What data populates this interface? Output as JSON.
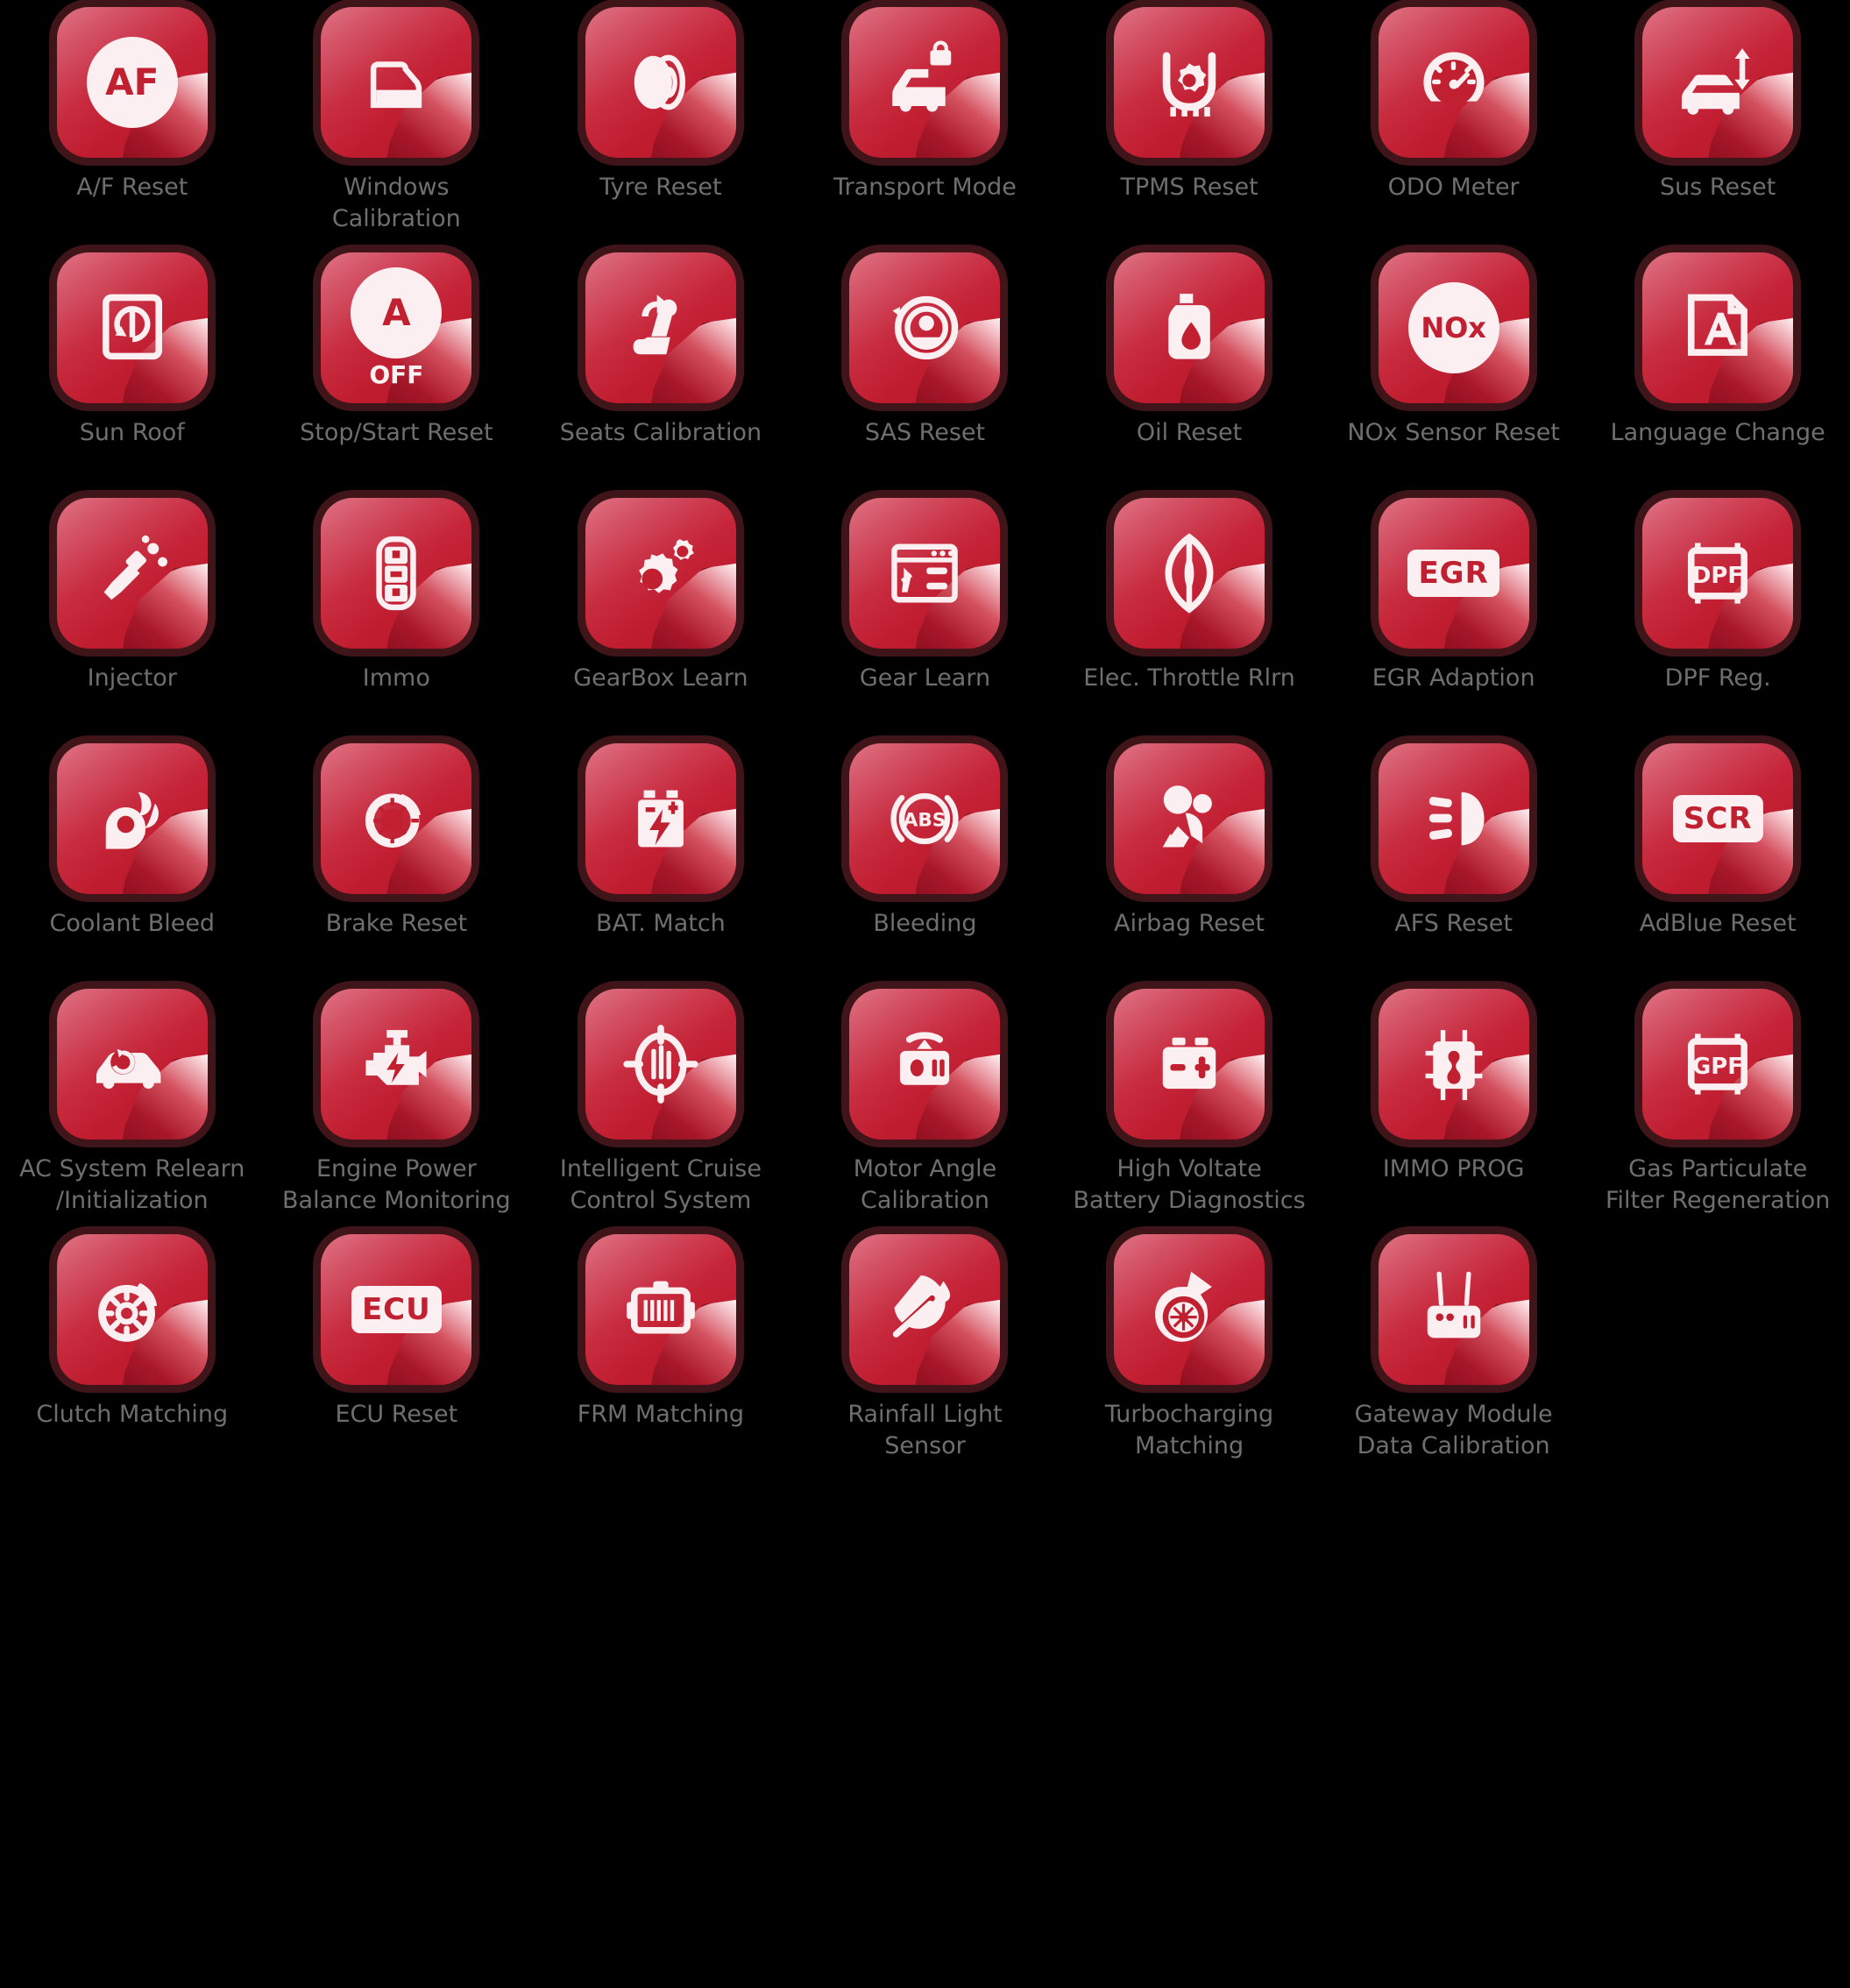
{
  "page": {
    "background_color": "#000000",
    "tile_color": "#c62438",
    "glyph_color": "#fbeff1",
    "label_color": "#6f6f6f",
    "columns": 7
  },
  "items": [
    {
      "label": "A/F Reset",
      "icon": "af-badge-icon",
      "row": 1,
      "col": 1
    },
    {
      "label": "Windows\nCalibration",
      "icon": "car-door-window-icon",
      "row": 1,
      "col": 2
    },
    {
      "label": "Tyre Reset",
      "icon": "tyre-icon",
      "row": 1,
      "col": 3
    },
    {
      "label": "Transport Mode",
      "icon": "car-lock-icon",
      "row": 1,
      "col": 4
    },
    {
      "label": "TPMS Reset",
      "icon": "tyre-pressure-gear-icon",
      "row": 1,
      "col": 5
    },
    {
      "label": "ODO Meter",
      "icon": "odometer-gauge-icon",
      "row": 1,
      "col": 6
    },
    {
      "label": "Sus Reset",
      "icon": "car-suspension-arrows-icon",
      "row": 1,
      "col": 7
    },
    {
      "label": "Sun Roof",
      "icon": "sunroof-panel-icon",
      "row": 2,
      "col": 1
    },
    {
      "label": "Stop/Start Reset",
      "icon": "a-off-badge-icon",
      "row": 2,
      "col": 2
    },
    {
      "label": "Seats Calibration",
      "icon": "seat-rotate-icon",
      "row": 2,
      "col": 3
    },
    {
      "label": "SAS Reset",
      "icon": "steering-angle-sensor-icon",
      "row": 2,
      "col": 4
    },
    {
      "label": "Oil Reset",
      "icon": "oil-can-icon",
      "row": 2,
      "col": 5
    },
    {
      "label": "NOx Sensor Reset",
      "icon": "nox-badge-icon",
      "row": 2,
      "col": 6
    },
    {
      "label": "Language Change",
      "icon": "language-book-a-icon",
      "row": 2,
      "col": 7
    },
    {
      "label": "Injector",
      "icon": "injector-spray-icon",
      "row": 3,
      "col": 1
    },
    {
      "label": "Immo",
      "icon": "car-key-fob-icon",
      "row": 3,
      "col": 2
    },
    {
      "label": "GearBox Learn",
      "icon": "double-gear-icon",
      "row": 3,
      "col": 3
    },
    {
      "label": "Gear Learn",
      "icon": "gear-learn-screen-icon",
      "row": 3,
      "col": 4
    },
    {
      "label": "Elec. Throttle Rlrn",
      "icon": "throttle-body-icon",
      "row": 3,
      "col": 5
    },
    {
      "label": "EGR Adaption",
      "icon": "egr-badge-icon",
      "row": 3,
      "col": 6
    },
    {
      "label": "DPF Reg.",
      "icon": "dpf-filter-icon",
      "row": 3,
      "col": 7
    },
    {
      "label": "Coolant Bleed",
      "icon": "coolant-pump-fan-icon",
      "row": 4,
      "col": 1
    },
    {
      "label": "Brake Reset",
      "icon": "brake-disc-caliper-icon",
      "row": 4,
      "col": 2
    },
    {
      "label": "BAT. Match",
      "icon": "battery-bolt-icon",
      "row": 4,
      "col": 3
    },
    {
      "label": "Bleeding",
      "icon": "abs-badge-icon",
      "row": 4,
      "col": 4
    },
    {
      "label": "Airbag Reset",
      "icon": "airbag-seatbelt-icon",
      "row": 4,
      "col": 5
    },
    {
      "label": "AFS Reset",
      "icon": "headlight-beam-icon",
      "row": 4,
      "col": 6
    },
    {
      "label": "AdBlue Reset",
      "icon": "scr-badge-icon",
      "row": 4,
      "col": 7
    },
    {
      "label": "AC System Relearn\n/Initialization",
      "icon": "car-ac-relearn-icon",
      "row": 5,
      "col": 1
    },
    {
      "label": "Engine Power\nBalance Monitoring",
      "icon": "engine-bolt-icon",
      "row": 5,
      "col": 2
    },
    {
      "label": "Intelligent Cruise\nControl System",
      "icon": "cruise-target-icon",
      "row": 5,
      "col": 3
    },
    {
      "label": "Motor Angle\nCalibration",
      "icon": "motor-angle-module-icon",
      "row": 5,
      "col": 4
    },
    {
      "label": "High Voltate\nBattery Diagnostics",
      "icon": "hv-battery-icon",
      "row": 5,
      "col": 5
    },
    {
      "label": "IMMO PROG",
      "icon": "immo-chip-icon",
      "row": 5,
      "col": 6
    },
    {
      "label": "Gas Particulate\nFilter Regeneration",
      "icon": "gpf-filter-icon",
      "row": 5,
      "col": 7
    },
    {
      "label": "Clutch Matching",
      "icon": "clutch-disc-icon",
      "row": 6,
      "col": 1
    },
    {
      "label": "ECU Reset",
      "icon": "ecu-badge-icon",
      "row": 6,
      "col": 2
    },
    {
      "label": "FRM Matching",
      "icon": "frm-module-icon",
      "row": 6,
      "col": 3
    },
    {
      "label": "Rainfall Light\nSensor",
      "icon": "rain-wiper-sensor-icon",
      "row": 6,
      "col": 4
    },
    {
      "label": "Turbocharging\nMatching",
      "icon": "turbocharger-icon",
      "row": 6,
      "col": 5
    },
    {
      "label": "Gateway Module\nData Calibration",
      "icon": "gateway-router-icon",
      "row": 6,
      "col": 6
    }
  ]
}
